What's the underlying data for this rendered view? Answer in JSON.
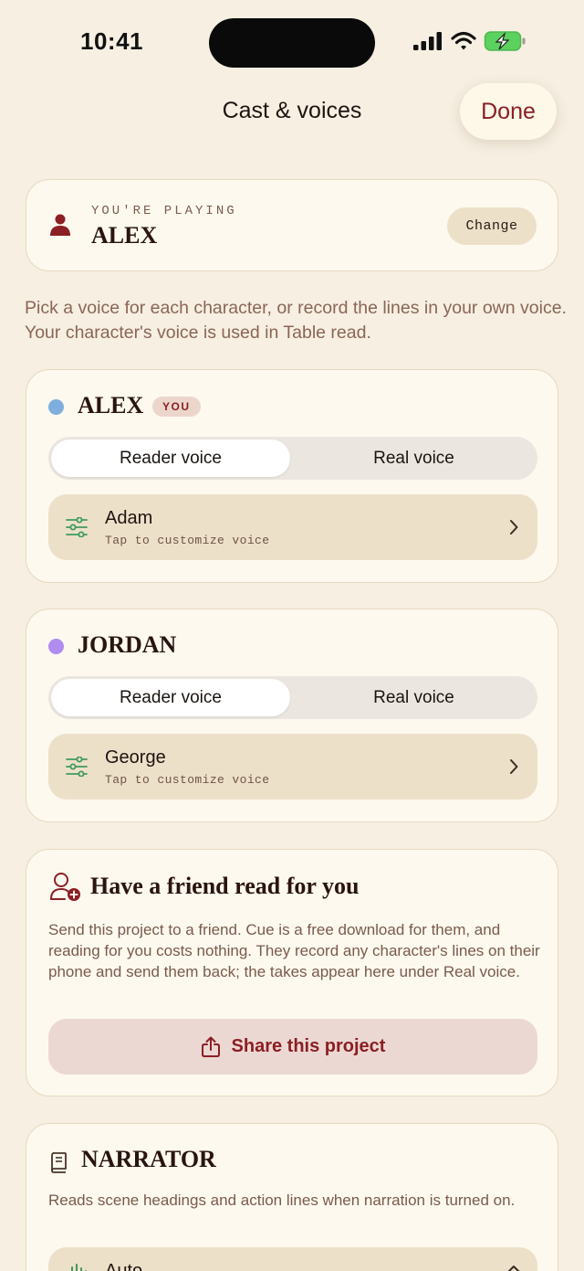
{
  "status_bar": {
    "time": "10:41"
  },
  "nav": {
    "title": "Cast & voices",
    "done_label": "Done"
  },
  "playing": {
    "label": "YOU'RE PLAYING",
    "name": "ALEX",
    "change_label": "Change"
  },
  "intro": "Pick a voice for each character, or record the lines in your own voice. Your character's voice is used in Table read.",
  "characters": [
    {
      "name": "ALEX",
      "dot_color": "#7eaedc",
      "badge": "YOU",
      "options": [
        "Reader voice",
        "Real voice"
      ],
      "selected": "Reader voice",
      "voice": "Adam",
      "voice_hint": "Tap to customize voice"
    },
    {
      "name": "JORDAN",
      "dot_color": "#b08cf0",
      "options": [
        "Reader voice",
        "Real voice"
      ],
      "selected": "Reader voice",
      "voice": "George",
      "voice_hint": "Tap to customize voice"
    }
  ],
  "friend": {
    "title": "Have a friend read for you",
    "body": "Send this project to a friend. Cue is a free download for them, and reading for you costs nothing. They record any character's lines on their phone and send them back; the takes appear here under Real voice.",
    "share_label": "Share this project"
  },
  "narrator": {
    "title": "NARRATOR",
    "body": "Reads scene headings and action lines when narration is turned on.",
    "value": "Auto"
  },
  "colors": {
    "accent": "#8b1f24",
    "background": "#f6efe2",
    "card": "#fdf9ef",
    "voice_icon": "#3f9a5e"
  },
  "icons": [
    "person-icon",
    "sliders-icon",
    "chevron-right-icon",
    "person-add-icon",
    "share-icon",
    "book-icon",
    "waveform-icon",
    "chevron-up-icon"
  ]
}
